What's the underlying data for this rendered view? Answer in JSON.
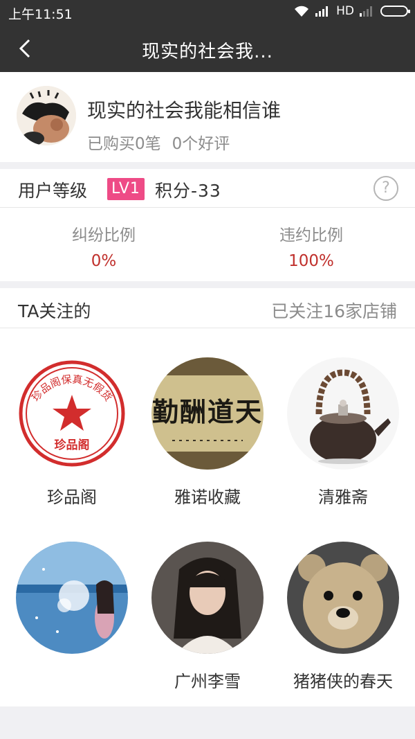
{
  "status_bar": {
    "time": "上午11:51",
    "network": "HD"
  },
  "nav": {
    "title": "现实的社会我..."
  },
  "profile": {
    "name": "现实的社会我能相信谁",
    "purchases": "已购买0笔",
    "reviews": "0个好评"
  },
  "level": {
    "label": "用户等级",
    "badge": "LV1",
    "score": "积分-33"
  },
  "ratios": [
    {
      "label": "纠纷比例",
      "value": "0%"
    },
    {
      "label": "违约比例",
      "value": "100%"
    }
  ],
  "follow": {
    "title": "TA关注的",
    "count": "已关注16家店铺"
  },
  "shops": [
    {
      "name": "珍品阁",
      "seal_text": "珍品阁保真无假货",
      "seal_center": "珍品阁"
    },
    {
      "name": "雅诺收藏",
      "calligraphy": "天道酬勤"
    },
    {
      "name": "清雅斋"
    },
    {
      "name": ""
    },
    {
      "name": "广州李雪"
    },
    {
      "name": "猪猪侠的春天"
    }
  ],
  "colors": {
    "bar": "#333333",
    "badge": "#ee4b86",
    "ratio_value": "#c0302c"
  }
}
